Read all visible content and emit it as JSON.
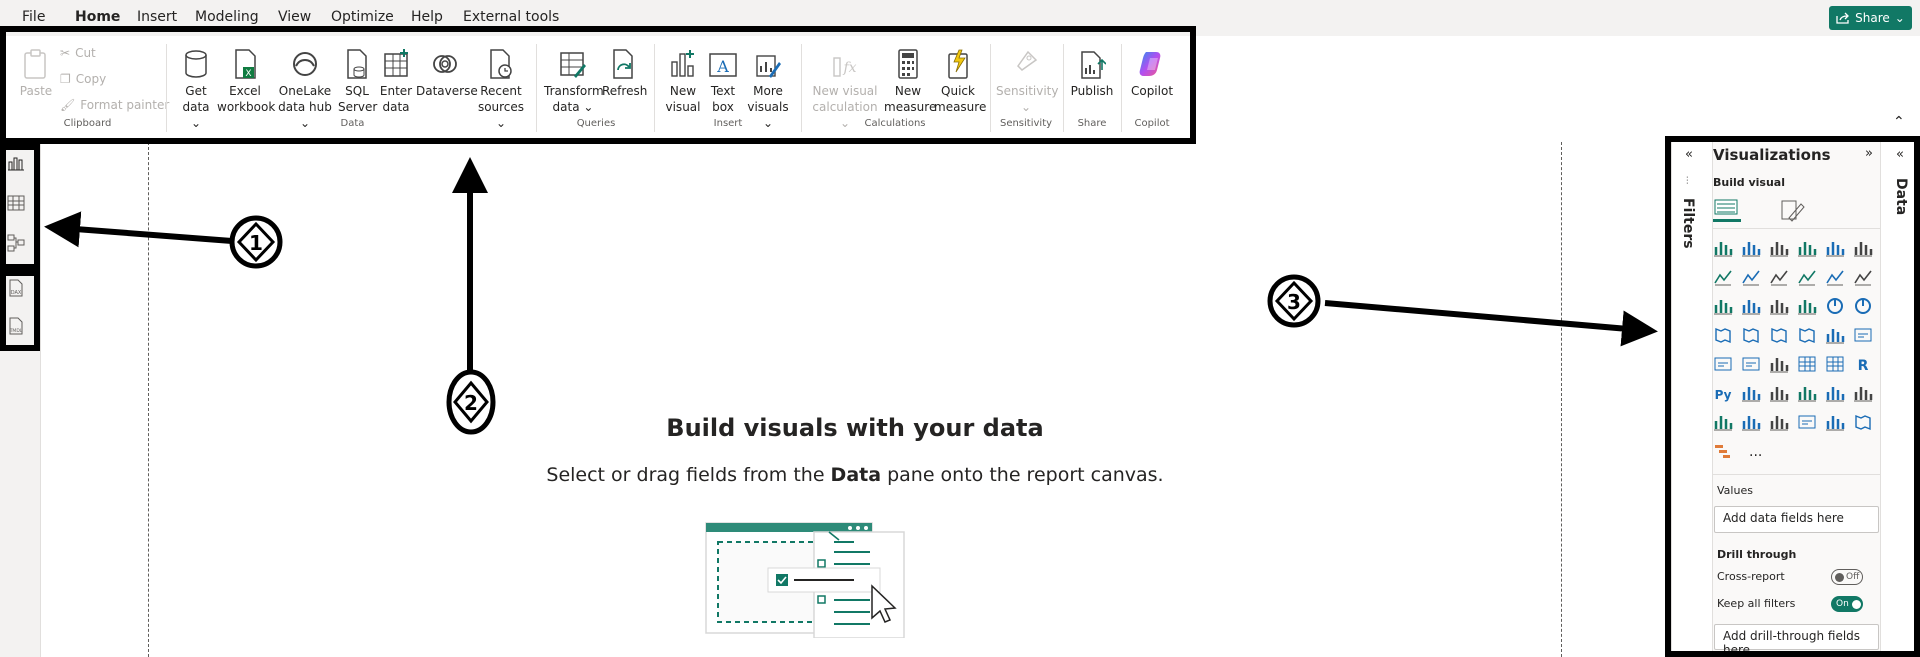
{
  "menu": {
    "items": [
      "File",
      "Home",
      "Insert",
      "Modeling",
      "View",
      "Optimize",
      "Help",
      "External tools"
    ],
    "active": "Home",
    "share_label": "Share"
  },
  "ribbon": {
    "clipboard": {
      "paste": "Paste",
      "cut": "Cut",
      "copy": "Copy",
      "format_painter": "Format painter",
      "group": "Clipboard"
    },
    "data": {
      "get_data": [
        "Get",
        "data ⌄"
      ],
      "excel": [
        "Excel",
        "workbook"
      ],
      "onelake": [
        "OneLake",
        "data hub ⌄"
      ],
      "sql": [
        "SQL",
        "Server"
      ],
      "enter": [
        "Enter",
        "data"
      ],
      "dataverse": "Dataverse",
      "recent": [
        "Recent",
        "sources ⌄"
      ],
      "group": "Data"
    },
    "queries": {
      "transform": [
        "Transform",
        "data ⌄"
      ],
      "refresh": "Refresh",
      "group": "Queries"
    },
    "insert": {
      "new_visual": [
        "New",
        "visual"
      ],
      "text_box": [
        "Text",
        "box"
      ],
      "more_visuals": [
        "More",
        "visuals ⌄"
      ],
      "group": "Insert"
    },
    "calculations": {
      "new_visual_calc": [
        "New visual",
        "calculation ⌄"
      ],
      "new_measure": [
        "New",
        "measure"
      ],
      "quick_measure": [
        "Quick",
        "measure"
      ],
      "group": "Calculations"
    },
    "sensitivity": {
      "label": [
        "Sensitivity",
        "⌄"
      ],
      "group": "Sensitivity"
    },
    "share": {
      "publish": "Publish",
      "group": "Share"
    },
    "copilot": {
      "label": "Copilot",
      "group": "Copilot"
    }
  },
  "left_rail": {
    "icons": [
      "report-view-icon",
      "table-view-icon",
      "model-view-icon",
      "dax-query-icon",
      "tmdl-icon"
    ]
  },
  "canvas": {
    "heading": "Build visuals with your data",
    "subtext_before": "Select or drag fields from the ",
    "subtext_bold": "Data",
    "subtext_after": " pane onto the report canvas."
  },
  "filters_pane": {
    "label": "Filters"
  },
  "data_pane": {
    "label": "Data"
  },
  "visualizations": {
    "title": "Visualizations",
    "build_visual": "Build visual",
    "values_label": "Values",
    "values_placeholder": "Add data fields here",
    "drill_through": "Drill through",
    "cross_report": "Cross-report",
    "cross_report_state": "Off",
    "keep_all_filters": "Keep all filters",
    "keep_all_filters_state": "On",
    "drill_placeholder": "Add drill-through fields here",
    "more": "..."
  },
  "annotations": [
    "1",
    "2",
    "3"
  ],
  "colors": {
    "accent": "#117865",
    "annotation": "#000000"
  }
}
